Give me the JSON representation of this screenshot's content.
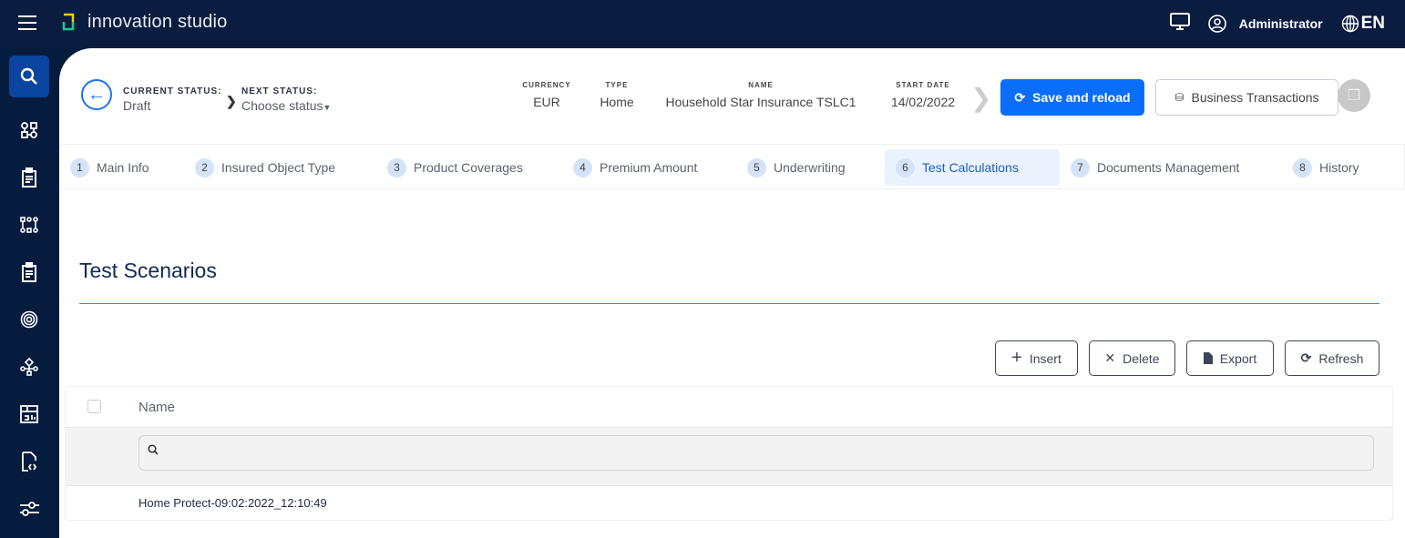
{
  "topbar": {
    "brand": "innovation studio",
    "user": "Administrator",
    "language": "EN"
  },
  "header": {
    "current_status_label": "CURRENT STATUS:",
    "current_status": "Draft",
    "next_status_label": "NEXT STATUS:",
    "next_status": "Choose status",
    "meta": [
      {
        "label": "CURRENCY",
        "value": "EUR"
      },
      {
        "label": "TYPE",
        "value": "Home"
      },
      {
        "label": "NAME",
        "value": "Household Star Insurance TSLC1"
      },
      {
        "label": "START DATE",
        "value": "14/02/2022"
      }
    ],
    "save_label": "Save and reload",
    "business_label": "Business Transactions"
  },
  "tabs": [
    {
      "num": "1",
      "label": "Main Info"
    },
    {
      "num": "2",
      "label": "Insured Object Type"
    },
    {
      "num": "3",
      "label": "Product Coverages"
    },
    {
      "num": "4",
      "label": "Premium Amount"
    },
    {
      "num": "5",
      "label": "Underwriting"
    },
    {
      "num": "6",
      "label": "Test Calculations"
    },
    {
      "num": "7",
      "label": "Documents Management"
    },
    {
      "num": "8",
      "label": "History"
    }
  ],
  "section": {
    "title": "Test Scenarios",
    "insert": "Insert",
    "delete": "Delete",
    "export": "Export",
    "refresh": "Refresh"
  },
  "table": {
    "column": "Name",
    "search_placeholder": "",
    "rows": [
      "Home Protect-09:02:2022_12:10:49"
    ]
  },
  "colors": {
    "topbar": "#0a1d40",
    "primary": "#0a6efa",
    "active_tab": "#e9f2fd"
  }
}
